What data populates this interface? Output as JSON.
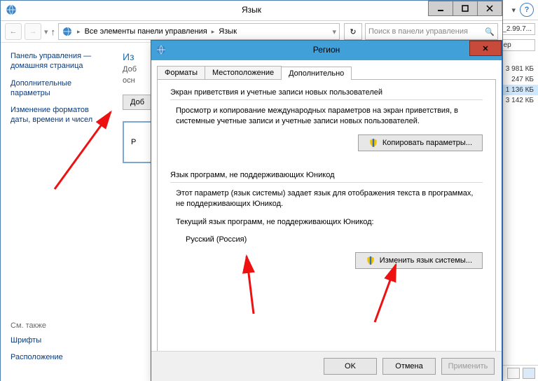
{
  "lang_window": {
    "title": "Язык",
    "nav": {
      "crumb1": "Все элементы панели управления",
      "crumb2": "Язык"
    },
    "search_placeholder": "Поиск в панели управления",
    "sidebar": {
      "items": [
        "Панель управления — домашняя страница",
        "Дополнительные параметры",
        "Изменение форматов даты, времени и чисел"
      ],
      "footer_header": "См. также",
      "footer_items": [
        "Шрифты",
        "Расположение"
      ]
    },
    "content": {
      "heading_fragment": "Из",
      "sub_fragment1": "Доб",
      "sub_fragment2": "осн",
      "add_btn_fragment": "Доб",
      "item_fragment": "Р"
    }
  },
  "region": {
    "title": "Регион",
    "tabs": [
      "Форматы",
      "Местоположение",
      "Дополнительно"
    ],
    "active_tab": 2,
    "group1": {
      "title": "Экран приветствия и учетные записи новых пользователей",
      "text": "Просмотр и копирование международных параметров на экран приветствия, в системные учетные записи и учетные записи новых пользователей.",
      "button": "Копировать параметры..."
    },
    "group2": {
      "title": "Язык программ, не поддерживающих Юникод",
      "text": "Этот параметр (язык системы) задает язык для отображения текста в программах, не поддерживающих Юникод.",
      "current_label": "Текущий язык программ, не поддерживающих Юникод:",
      "current_value": "Русский (Россия)",
      "button": "Изменить язык системы..."
    },
    "footer": {
      "ok": "OK",
      "cancel": "Отмена",
      "apply": "Применить"
    }
  },
  "rightpane": {
    "addr_fragment": "_2.99.7...",
    "btn_fragment": "иер",
    "sizes": [
      "3 981 КБ",
      "247 КБ",
      "1 136 КБ",
      "3 142 КБ"
    ]
  }
}
